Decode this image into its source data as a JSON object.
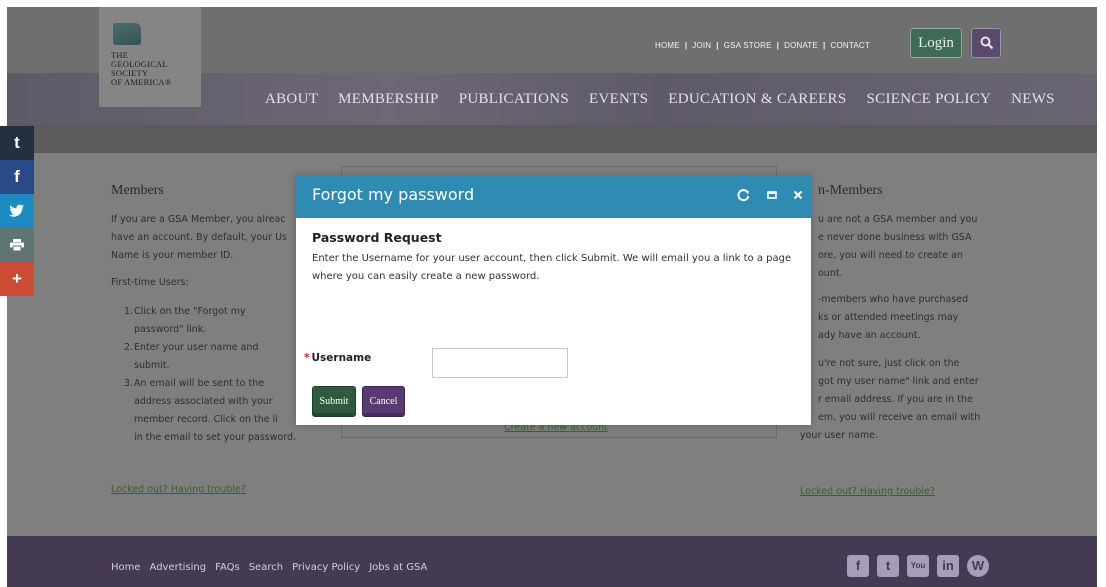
{
  "header": {
    "logo_text": "THE\nGEOLOGICAL\nSOCIETY\nOF AMERICA®",
    "util_nav": [
      "HOME",
      "JOIN",
      "GSA STORE",
      "DONATE",
      "CONTACT"
    ],
    "util_sep": "|",
    "login_label": "Login",
    "main_nav": [
      "ABOUT",
      "MEMBERSHIP",
      "PUBLICATIONS",
      "EVENTS",
      "EDUCATION & CAREERS",
      "SCIENCE POLICY",
      "NEWS"
    ]
  },
  "share_bar": [
    "t",
    "f",
    "y",
    "p",
    "+"
  ],
  "members": {
    "title": "Members",
    "text_lines": [
      "If you are a GSA Member, you alreac",
      "have an account. By default, your Us",
      "Name is your member ID."
    ],
    "first_time": "First-time Users:",
    "steps": [
      {
        "n": "1.",
        "lines": [
          "Click on the \"Forgot my",
          "password\" link."
        ]
      },
      {
        "n": "2.",
        "lines": [
          "Enter your user name and",
          "submit."
        ]
      },
      {
        "n": "3.",
        "lines": [
          "An email will be sent to the",
          "address associated with your",
          "member record. Click on the li",
          "in the email to set your password."
        ]
      }
    ],
    "trouble_link": "Locked out? Having trouble?"
  },
  "center": {
    "create_link": "Create a new account"
  },
  "nonmembers": {
    "title": "n-Members",
    "paragraphs": [
      [
        "u are not a GSA member and you",
        "e never done business with GSA",
        "ore, you will need to create an",
        "ount."
      ],
      [
        "-members who have purchased",
        "ks or attended meetings may",
        "ady have an account."
      ],
      [
        "u're not sure, just click on the",
        "got my user name\" link and enter",
        "r email address. If you are in the",
        "em, you will receive an email with",
        "your user name."
      ]
    ],
    "trouble_link": "Locked out? Having trouble?"
  },
  "footer": {
    "links": [
      "Home",
      "Advertising",
      "FAQs",
      "Search",
      "Privacy Policy",
      "Jobs at GSA"
    ],
    "social": [
      "f",
      "t",
      "You",
      "in",
      "W"
    ]
  },
  "modal": {
    "title": "Forgot my password",
    "heading": "Password Request",
    "instructions": "Enter the Username for your user account, then click Submit. We will email you a link to a page where you can easily create a new password.",
    "required_marker": "*",
    "username_label": "Username",
    "username_value": "",
    "submit_label": "Submit",
    "cancel_label": "Cancel"
  },
  "colors": {
    "modal_header": "#2f8bb1",
    "submit": "#2f5a3f",
    "cancel": "#5a3a73",
    "footer": "#443a52"
  }
}
